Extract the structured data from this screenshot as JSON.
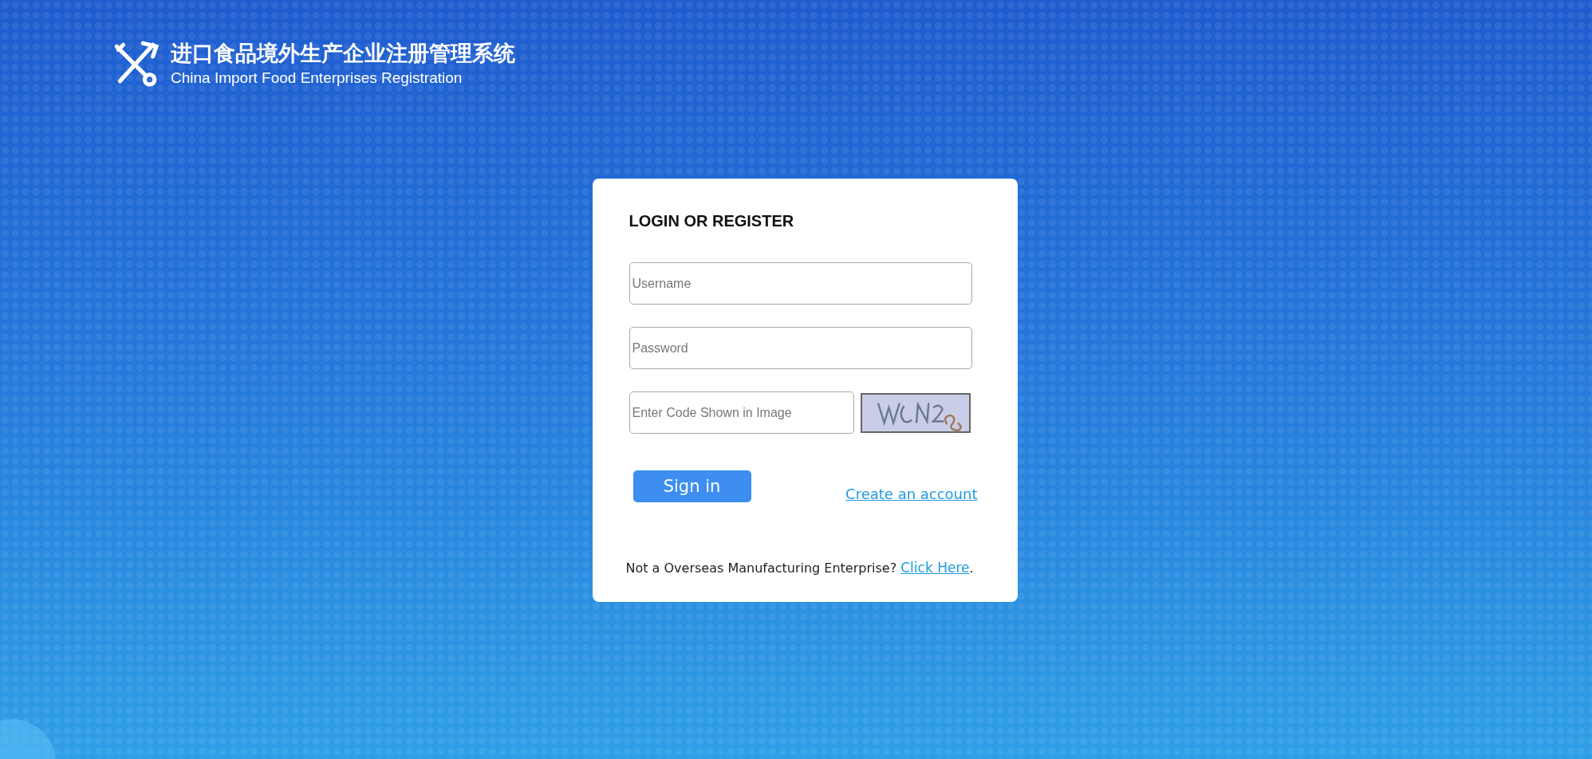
{
  "brand": {
    "title_cn": "进口食品境外生产企业注册管理系统",
    "title_en": "China Import Food Enterprises Registration"
  },
  "login": {
    "heading": "LOGIN OR REGISTER",
    "username": {
      "placeholder": "Username"
    },
    "password": {
      "placeholder": "Password"
    },
    "captcha": {
      "placeholder": "Enter Code Shown in Image"
    },
    "sign_in": "Sign in",
    "create_account": "Create an account",
    "footer": {
      "text": "Not a Overseas Manufacturing Enterprise?",
      "link": "Click Here",
      "suffix": "."
    }
  }
}
